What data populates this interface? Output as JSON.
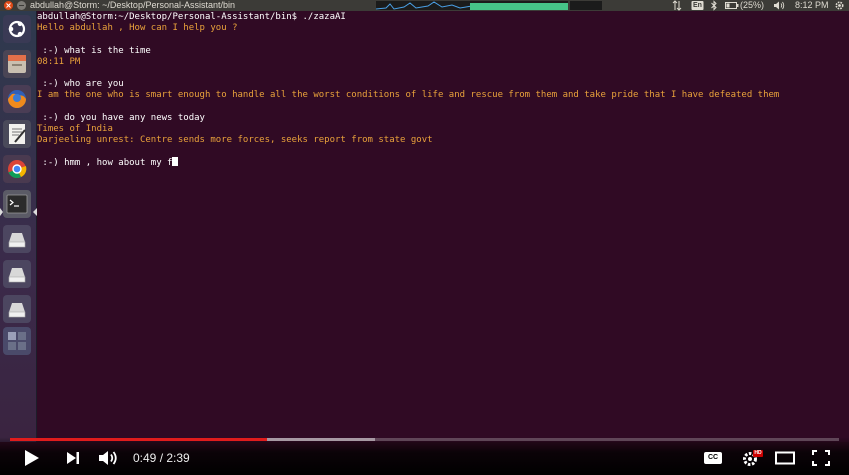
{
  "window": {
    "title": "abdullah@Storm: ~/Desktop/Personal-Assistant/bin"
  },
  "panel": {
    "keyboard_layout": "En",
    "battery": "(25%)",
    "clock": "8:12 PM"
  },
  "terminal": {
    "lines": [
      {
        "text": "abdullah@Storm:~/Desktop/Personal-Assistant/bin$ ./zazaAI",
        "kind": "prompt"
      },
      {
        "text": "Hello abdullah , How can I help you ?",
        "kind": "output"
      },
      {
        "text": "",
        "kind": "blank"
      },
      {
        "text": " :-) what is the time",
        "kind": "input"
      },
      {
        "text": "08:11 PM",
        "kind": "output"
      },
      {
        "text": "",
        "kind": "blank"
      },
      {
        "text": " :-) who are you",
        "kind": "input"
      },
      {
        "text": "I am the one who is smart enough to handle all the worst conditions of life and rescue from them and take pride that I have defeated them",
        "kind": "output"
      },
      {
        "text": "",
        "kind": "blank"
      },
      {
        "text": " :-) do you have any news today",
        "kind": "input"
      },
      {
        "text": "Times of India",
        "kind": "output"
      },
      {
        "text": "Darjeeling unrest: Centre sends more forces, seeks report from state govt",
        "kind": "output"
      },
      {
        "text": "",
        "kind": "blank"
      },
      {
        "text": " :-) hmm , how about my f",
        "kind": "input_active"
      }
    ]
  },
  "player": {
    "current_time": "0:49",
    "separator": " / ",
    "duration": "2:39",
    "played_fraction": 0.31,
    "buffered_fraction": 0.44,
    "colors": {
      "played": "#e01c1c",
      "hd_badge": "#cc0000"
    },
    "hd_badge_label": "HD",
    "cc_label": "CC"
  },
  "colors": {
    "terminal_background": "#300a24",
    "terminal_output": "#e9a23b",
    "terminal_text": "#ffffff",
    "panel_background": "#3c3b37"
  },
  "icons": {
    "launcher": [
      "ubuntu-dash-icon",
      "files-icon",
      "firefox-icon",
      "text-editor-icon",
      "chrome-icon",
      "terminal-icon",
      "drive-icon",
      "drive-icon",
      "drive-icon",
      "workspace-switcher-icon"
    ],
    "panel": [
      "network-graph-icon",
      "cpu-graph-icon",
      "transfer-icon",
      "keyboard-layout-icon",
      "bluetooth-icon",
      "battery-icon",
      "volume-icon",
      "settings-gear-icon"
    ],
    "player": [
      "play-icon",
      "next-icon",
      "volume-icon",
      "cc-icon",
      "settings-icon",
      "theater-mode-icon",
      "fullscreen-icon"
    ]
  }
}
